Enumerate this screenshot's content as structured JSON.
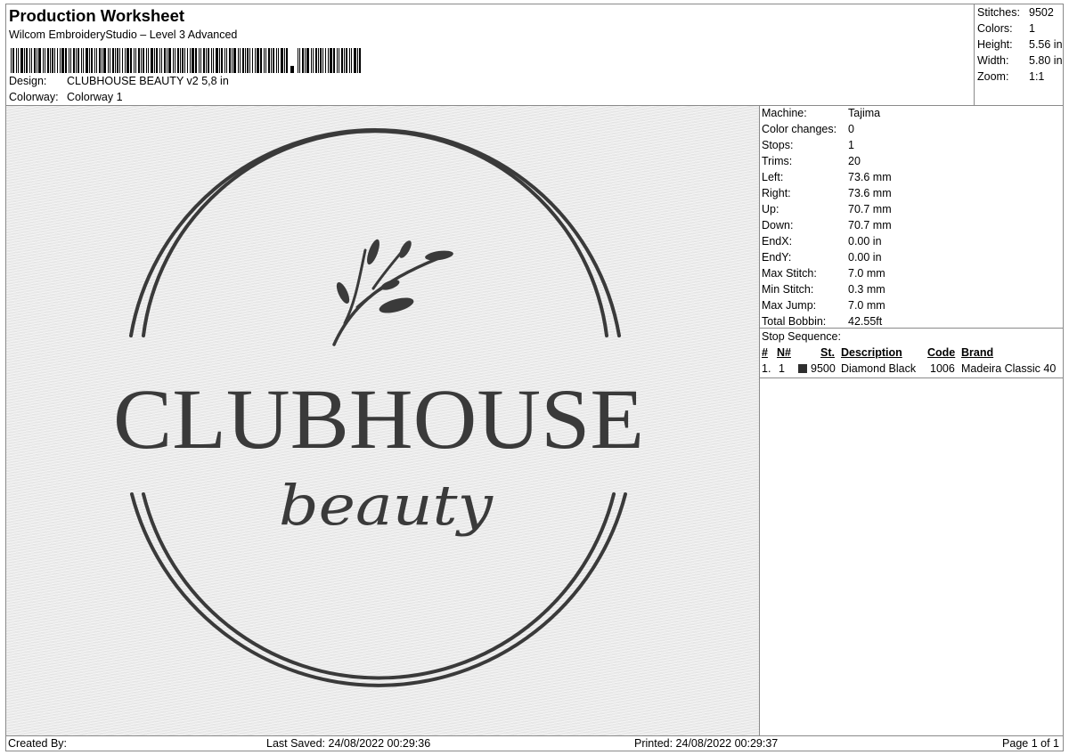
{
  "header": {
    "title": "Production Worksheet",
    "software": "Wilcom EmbroideryStudio – Level 3 Advanced",
    "design_label": "Design:",
    "design_value": "CLUBHOUSE BEAUTY v2 5,8 in",
    "colorway_label": "Colorway:",
    "colorway_value": "Colorway 1"
  },
  "stats": [
    {
      "label": "Stitches:",
      "value": "9502"
    },
    {
      "label": "Colors:",
      "value": "1"
    },
    {
      "label": "Height:",
      "value": "5.56 in"
    },
    {
      "label": "Width:",
      "value": "5.80 in"
    },
    {
      "label": "Zoom:",
      "value": "1:1"
    }
  ],
  "machine_info": [
    {
      "label": "Machine:",
      "value": "Tajima"
    },
    {
      "label": "Color changes:",
      "value": "0"
    },
    {
      "label": "Stops:",
      "value": "1"
    },
    {
      "label": "Trims:",
      "value": "20"
    },
    {
      "label": "Left:",
      "value": "73.6 mm"
    },
    {
      "label": "Right:",
      "value": "73.6 mm"
    },
    {
      "label": "Up:",
      "value": "70.7 mm"
    },
    {
      "label": "Down:",
      "value": "70.7 mm"
    },
    {
      "label": "EndX:",
      "value": "0.00 in"
    },
    {
      "label": "EndY:",
      "value": "0.00 in"
    },
    {
      "label": "Max Stitch:",
      "value": "7.0 mm"
    },
    {
      "label": "Min Stitch:",
      "value": "0.3 mm"
    },
    {
      "label": "Max Jump:",
      "value": "7.0 mm"
    },
    {
      "label": "Total Bobbin:",
      "value": "42.55ft"
    }
  ],
  "stop_sequence": {
    "label": "Stop Sequence:",
    "headers": {
      "num": "#",
      "n": "N#",
      "st": "St.",
      "description": "Description",
      "code": "Code",
      "brand": "Brand"
    },
    "rows": [
      {
        "num": "1.",
        "n": "1",
        "st": "9500",
        "description": "Diamond Black",
        "code": "1006",
        "brand": "Madeira Classic 40",
        "color": "#2e2e2e"
      }
    ]
  },
  "design_preview": {
    "main_text": "CLUBHOUSE",
    "script_text": "beauty",
    "thread_color": "#3a3a3a",
    "fabric_color": "#e9e9e9"
  },
  "footer": {
    "created_by": "Created By:",
    "last_saved": "Last Saved: 24/08/2022 00:29:36",
    "printed": "Printed: 24/08/2022 00:29:37",
    "page": "Page 1 of 1"
  }
}
